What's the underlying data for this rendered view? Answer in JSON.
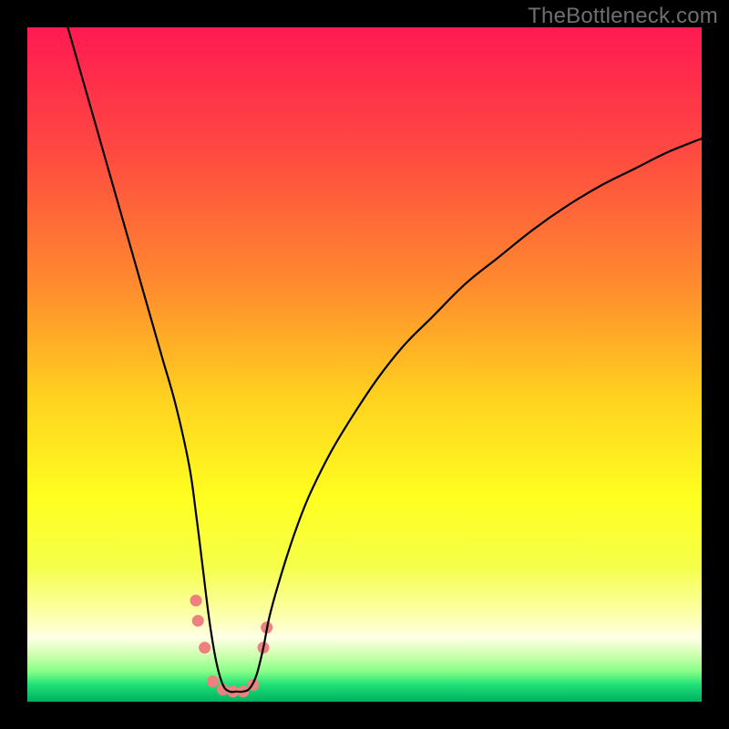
{
  "watermark": "TheBottleneck.com",
  "chart_data": {
    "type": "line",
    "title": "",
    "xlabel": "",
    "ylabel": "",
    "xlim": [
      0,
      100
    ],
    "ylim": [
      0,
      100
    ],
    "grid": false,
    "series": [
      {
        "name": "bottleneck-curve",
        "x": [
          6,
          8,
          10,
          12,
          14,
          16,
          18,
          20,
          22,
          24,
          25,
          26,
          27,
          28,
          29,
          30,
          31,
          32,
          33,
          34,
          35,
          36,
          38,
          40,
          42,
          45,
          48,
          52,
          56,
          60,
          65,
          70,
          75,
          80,
          85,
          90,
          95,
          100
        ],
        "y": [
          100,
          93,
          86,
          79,
          72,
          65,
          58,
          51,
          44,
          35,
          28,
          20,
          12,
          6,
          2.5,
          1.5,
          1.5,
          1.5,
          2,
          4,
          8,
          13,
          20,
          26,
          31,
          37,
          42,
          48,
          53,
          57,
          62,
          66,
          70,
          73.5,
          76.5,
          79,
          81.5,
          83.5
        ]
      }
    ],
    "markers": {
      "name": "accent-dots",
      "color": "#ef8080",
      "points": [
        {
          "x": 25.0,
          "y": 15,
          "r": 6.5
        },
        {
          "x": 25.3,
          "y": 12,
          "r": 6.5
        },
        {
          "x": 26.3,
          "y": 8,
          "r": 6.5
        },
        {
          "x": 27.5,
          "y": 3,
          "r": 6.5
        },
        {
          "x": 29.0,
          "y": 1.8,
          "r": 6.5
        },
        {
          "x": 30.5,
          "y": 1.5,
          "r": 6.5
        },
        {
          "x": 32.0,
          "y": 1.5,
          "r": 6.5
        },
        {
          "x": 33.5,
          "y": 2.5,
          "r": 6.5
        },
        {
          "x": 35.0,
          "y": 8,
          "r": 6.5
        },
        {
          "x": 35.5,
          "y": 11,
          "r": 6.5
        }
      ]
    },
    "background_gradient": {
      "direction": "vertical",
      "stops": [
        {
          "offset": 0.0,
          "color": "#ff1a52"
        },
        {
          "offset": 0.18,
          "color": "#ff4842"
        },
        {
          "offset": 0.38,
          "color": "#ff8a2e"
        },
        {
          "offset": 0.55,
          "color": "#ffd21f"
        },
        {
          "offset": 0.7,
          "color": "#ffff20"
        },
        {
          "offset": 0.8,
          "color": "#f5ff4a"
        },
        {
          "offset": 0.87,
          "color": "#fcffa8"
        },
        {
          "offset": 0.905,
          "color": "#ffffe6"
        },
        {
          "offset": 0.93,
          "color": "#d0ffb0"
        },
        {
          "offset": 0.955,
          "color": "#88ff88"
        },
        {
          "offset": 0.975,
          "color": "#1fe077"
        },
        {
          "offset": 1.0,
          "color": "#00b060"
        }
      ]
    }
  }
}
